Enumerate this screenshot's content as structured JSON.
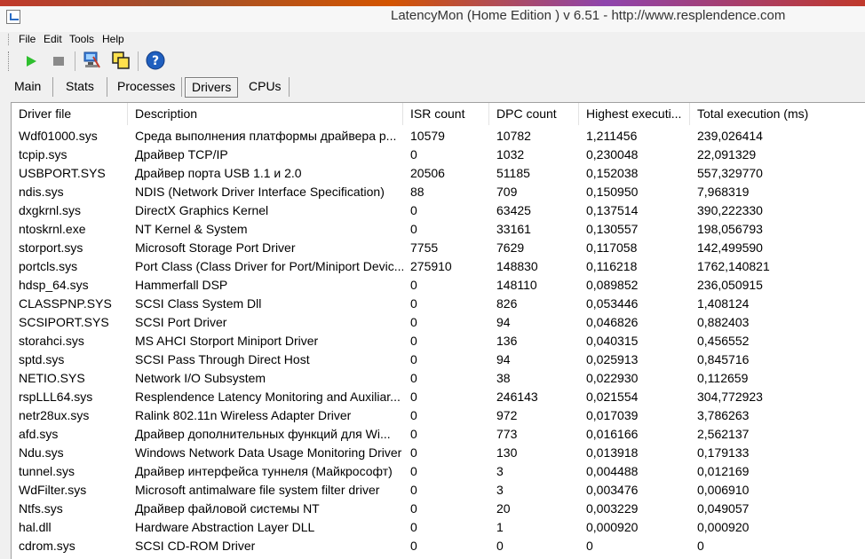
{
  "window": {
    "title": "LatencyMon  (Home Edition )  v 6.51 - http://www.resplendence.com"
  },
  "menu": [
    "File",
    "Edit",
    "Tools",
    "Help"
  ],
  "toolbar": {
    "buttons": [
      {
        "name": "start-icon",
        "color": "#2fbf2f"
      },
      {
        "name": "stop-icon",
        "color": "#8a8a8a"
      },
      {
        "name": "settings-icon",
        "color": "#3a7bd5"
      },
      {
        "name": "copy-icon",
        "color": "#d4b000"
      },
      {
        "name": "help-icon",
        "color": "#1f5fbf"
      }
    ]
  },
  "tabs": [
    "Main",
    "Stats",
    "Processes",
    "Drivers",
    "CPUs"
  ],
  "active_tab": "Drivers",
  "table": {
    "columns": [
      "Driver file",
      "Description",
      "ISR count",
      "DPC count",
      "Highest executi...",
      "Total execution (ms)"
    ],
    "rows": [
      [
        "Wdf01000.sys",
        "Среда выполнения платформы драйвера р...",
        "10579",
        "10782",
        "1,211456",
        "239,026414"
      ],
      [
        "tcpip.sys",
        "Драйвер TCP/IP",
        "0",
        "1032",
        "0,230048",
        "22,091329"
      ],
      [
        "USBPORT.SYS",
        "Драйвер порта USB 1.1 и 2.0",
        "20506",
        "51185",
        "0,152038",
        "557,329770"
      ],
      [
        "ndis.sys",
        "NDIS (Network Driver Interface Specification)",
        "88",
        "709",
        "0,150950",
        "7,968319"
      ],
      [
        "dxgkrnl.sys",
        "DirectX Graphics Kernel",
        "0",
        "63425",
        "0,137514",
        "390,222330"
      ],
      [
        "ntoskrnl.exe",
        "NT Kernel & System",
        "0",
        "33161",
        "0,130557",
        "198,056793"
      ],
      [
        "storport.sys",
        "Microsoft Storage Port Driver",
        "7755",
        "7629",
        "0,117058",
        "142,499590"
      ],
      [
        "portcls.sys",
        "Port Class (Class Driver for Port/Miniport Devic...",
        "275910",
        "148830",
        "0,116218",
        "1762,140821"
      ],
      [
        "hdsp_64.sys",
        "Hammerfall DSP",
        "0",
        "148110",
        "0,089852",
        "236,050915"
      ],
      [
        "CLASSPNP.SYS",
        "SCSI Class System Dll",
        "0",
        "826",
        "0,053446",
        "1,408124"
      ],
      [
        "SCSIPORT.SYS",
        "SCSI Port Driver",
        "0",
        "94",
        "0,046826",
        "0,882403"
      ],
      [
        "storahci.sys",
        "MS AHCI Storport Miniport Driver",
        "0",
        "136",
        "0,040315",
        "0,456552"
      ],
      [
        "sptd.sys",
        "SCSI Pass Through Direct Host",
        "0",
        "94",
        "0,025913",
        "0,845716"
      ],
      [
        "NETIO.SYS",
        "Network I/O Subsystem",
        "0",
        "38",
        "0,022930",
        "0,112659"
      ],
      [
        "rspLLL64.sys",
        "Resplendence Latency Monitoring and Auxiliar...",
        "0",
        "246143",
        "0,021554",
        "304,772923"
      ],
      [
        "netr28ux.sys",
        "Ralink 802.11n Wireless Adapter Driver",
        "0",
        "972",
        "0,017039",
        "3,786263"
      ],
      [
        "afd.sys",
        "Драйвер дополнительных функций для Wi...",
        "0",
        "773",
        "0,016166",
        "2,562137"
      ],
      [
        "Ndu.sys",
        "Windows Network Data Usage Monitoring Driver",
        "0",
        "130",
        "0,013918",
        "0,179133"
      ],
      [
        "tunnel.sys",
        "Драйвер интерфейса туннеля (Майкрософт)",
        "0",
        "3",
        "0,004488",
        "0,012169"
      ],
      [
        "WdFilter.sys",
        "Microsoft antimalware file system filter driver",
        "0",
        "3",
        "0,003476",
        "0,006910"
      ],
      [
        "Ntfs.sys",
        "Драйвер файловой системы NT",
        "0",
        "20",
        "0,003229",
        "0,049057"
      ],
      [
        "hal.dll",
        "Hardware Abstraction Layer DLL",
        "0",
        "1",
        "0,000920",
        "0,000920"
      ],
      [
        "cdrom.sys",
        "SCSI CD-ROM Driver",
        "0",
        "0",
        "0",
        "0"
      ]
    ]
  }
}
